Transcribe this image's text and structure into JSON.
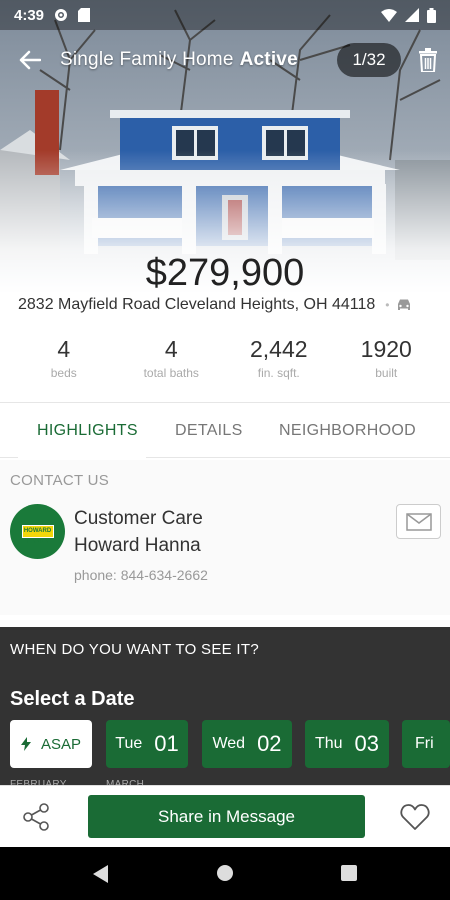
{
  "status_bar": {
    "time": "4:39",
    "icons": [
      "gear-icon",
      "sd-card-icon",
      "wifi-icon",
      "cellular-icon",
      "battery-icon"
    ]
  },
  "header": {
    "back_icon": "arrow-left-icon",
    "title": "Single Family Home",
    "status": "Active",
    "photo_counter": "1/32",
    "trash_icon": "trash-icon"
  },
  "listing": {
    "price": "$279,900",
    "address": "2832 Mayfield Road  Cleveland Heights, OH 44118",
    "address_separator": "•",
    "car_icon": "car-icon"
  },
  "stats": [
    {
      "value": "4",
      "label": "beds"
    },
    {
      "value": "4",
      "label": "total baths"
    },
    {
      "value": "2,442",
      "label": "fin. sqft."
    },
    {
      "value": "1920",
      "label": "built"
    }
  ],
  "tabs": [
    {
      "label": "HIGHLIGHTS",
      "active": true
    },
    {
      "label": "DETAILS",
      "active": false
    },
    {
      "label": "NEIGHBORHOOD",
      "active": false
    }
  ],
  "contact": {
    "heading": "CONTACT US",
    "logo_text": "HOWARD HANNA",
    "name_line1": "Customer Care",
    "name_line2": "Howard Hanna",
    "phone": "phone: 844-634-2662",
    "mail_icon": "envelope-icon"
  },
  "schedule": {
    "question": "WHEN DO YOU WANT TO SEE IT?",
    "title": "Select a Date",
    "asap_label": "ASAP",
    "dates": [
      {
        "dow": "Tue",
        "day": "01"
      },
      {
        "dow": "Wed",
        "day": "02"
      },
      {
        "dow": "Thu",
        "day": "03"
      },
      {
        "dow": "Fri",
        "day": ""
      }
    ],
    "month_labels": [
      "FEBRUARY",
      "MARCH"
    ]
  },
  "bottom_bar": {
    "share_label": "Share in Message",
    "share_icon": "share-icon",
    "favorite_icon": "heart-icon"
  },
  "colors": {
    "brand_green": "#1a6b35",
    "schedule_bg": "#333333"
  }
}
